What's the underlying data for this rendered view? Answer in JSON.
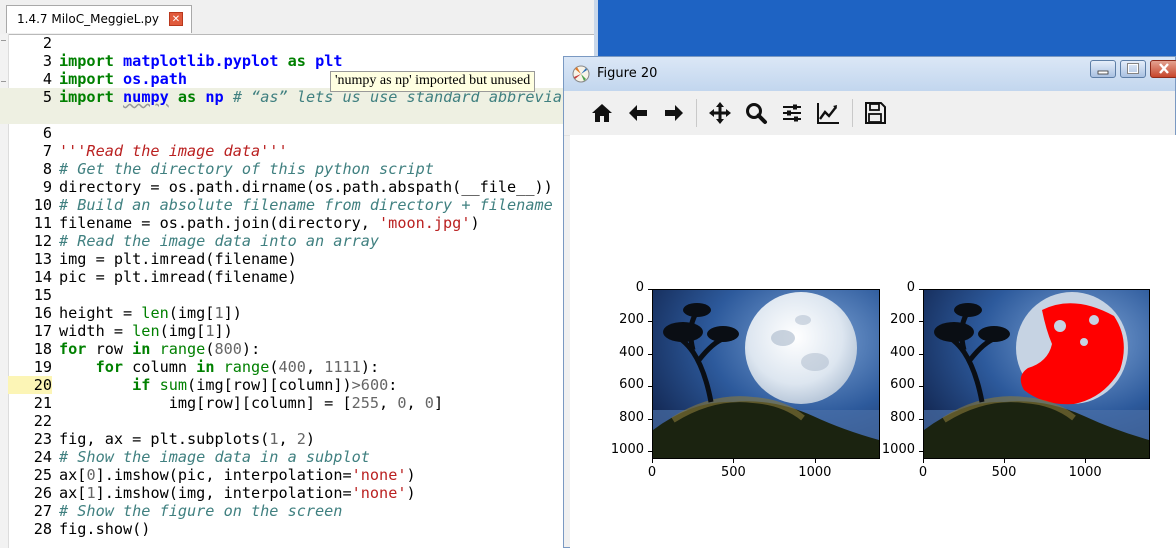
{
  "editor": {
    "tab_title": "1.4.7 MiloC_MeggieL.py",
    "tab_close_icon": "close-icon",
    "tooltip": "'numpy as np' imported but unused",
    "current_line": "20",
    "line_numbers": [
      "2",
      "3",
      "4",
      "5",
      "6",
      "7",
      "8",
      "9",
      "10",
      "11",
      "12",
      "13",
      "14",
      "15",
      "16",
      "17",
      "18",
      "19",
      "20",
      "21",
      "22",
      "23",
      "24",
      "25",
      "26",
      "27",
      "28"
    ],
    "code": {
      "l3": {
        "kw1": "import",
        "mod": "matplotlib.pyplot",
        "kw2": "as",
        "alias": "plt"
      },
      "l4": {
        "kw1": "import",
        "mod": "os.path"
      },
      "l5": {
        "kw1": "import",
        "mod": "numpy",
        "kw2": "as",
        "alias": "np",
        "comment": "# “as” lets us use standard abbrevia"
      },
      "l7": {
        "doc": "'''Read the image data'''"
      },
      "l8": {
        "comment": "# Get the directory of this python script"
      },
      "l9": {
        "text": "directory = os.path.dirname(os.path.abspath(__file__))"
      },
      "l10": {
        "comment": "# Build an absolute filename from directory + filename"
      },
      "l11": {
        "pre": "filename = os.path.join(directory, ",
        "str": "'moon.jpg'",
        "post": ")"
      },
      "l12": {
        "comment": "# Read the image data into an array"
      },
      "l13": {
        "text": "img = plt.imread(filename)"
      },
      "l14": {
        "text": "pic = plt.imread(filename)"
      },
      "l16": {
        "pre": "height = ",
        "fn": "len",
        "mid": "(img[",
        "num": "1",
        "post": "])"
      },
      "l17": {
        "pre": "width = ",
        "fn": "len",
        "mid": "(img[",
        "num": "1",
        "post": "])"
      },
      "l18": {
        "kw": "for",
        "pre": " row ",
        "kw2": "in",
        "sp": " ",
        "fn": "range",
        "mid": "(",
        "num": "800",
        "post": "):"
      },
      "l19": {
        "ind": "    ",
        "kw": "for",
        "pre": " column ",
        "kw2": "in",
        "sp": " ",
        "fn": "range",
        "mid": "(",
        "num": "400",
        "c": ", ",
        "num2": "1111",
        "post": "):"
      },
      "l20": {
        "ind": "        ",
        "kw": "if",
        "sp": " ",
        "fn": "sum",
        "mid": "(img[row][column])",
        "op": ">",
        "num": "600",
        "post": ":"
      },
      "l21": {
        "ind": "            ",
        "pre": "img[row][column] = [",
        "num": "255",
        "c1": ", ",
        "num2": "0",
        "c2": ", ",
        "num3": "0",
        "post": "]"
      },
      "l23": {
        "pre": "fig, ax = plt.subplots(",
        "num": "1",
        "c": ", ",
        "num2": "2",
        "post": ")"
      },
      "l24": {
        "comment": "# Show the image data in a subplot"
      },
      "l25": {
        "pre": "ax[",
        "num": "0",
        "mid": "].imshow(pic, interpolation=",
        "str": "'none'",
        "post": ")"
      },
      "l26": {
        "pre": "ax[",
        "num": "1",
        "mid": "].imshow(img, interpolation=",
        "str": "'none'",
        "post": ")"
      },
      "l27": {
        "comment": "# Show the figure on the screen"
      },
      "l28": {
        "text": "fig.show()"
      }
    }
  },
  "figure": {
    "title": "Figure 20",
    "toolbar_icons": [
      "home-icon",
      "back-arrow-icon",
      "forward-arrow-icon",
      "pan-icon",
      "zoom-icon",
      "subplots-config-icon",
      "edit-axes-icon",
      "save-icon"
    ],
    "colors": {
      "sky": "#2a4f8a",
      "moon": "#e8eef5",
      "red": "#ff0000",
      "ground": "#1a1f10"
    }
  },
  "chart_data": [
    {
      "type": "image",
      "xticks": [
        "0",
        "500",
        "1000"
      ],
      "yticks": [
        "0",
        "200",
        "400",
        "600",
        "800",
        "1000"
      ],
      "xlim": [
        0,
        1400
      ],
      "ylim": [
        1050,
        0
      ]
    },
    {
      "type": "image",
      "xticks": [
        "0",
        "500",
        "1000"
      ],
      "yticks": [
        "0",
        "200",
        "400",
        "600",
        "800",
        "1000"
      ],
      "xlim": [
        0,
        1400
      ],
      "ylim": [
        1050,
        0
      ]
    }
  ]
}
